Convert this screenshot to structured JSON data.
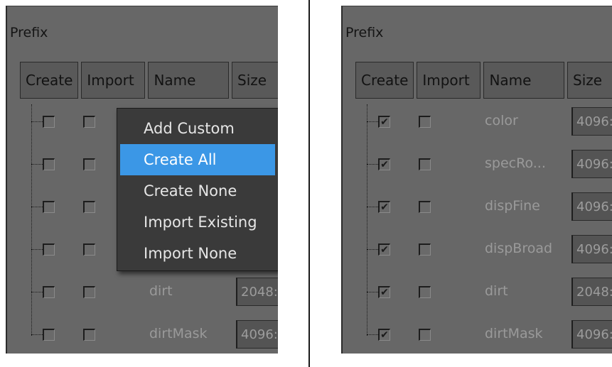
{
  "panels": [
    {
      "prefix_label": "Prefix",
      "columns": [
        "Create",
        "Import",
        "Name",
        "Size"
      ],
      "rows": [
        {
          "create": "",
          "import": "",
          "name": "",
          "size": ""
        },
        {
          "create": "",
          "import": "",
          "name": "",
          "size": ""
        },
        {
          "create": "",
          "import": "",
          "name": "",
          "size": ""
        },
        {
          "create": "",
          "import": "",
          "name": "",
          "size": ""
        },
        {
          "create": "",
          "import": "",
          "name": "dirt",
          "size": "2048:"
        },
        {
          "create": "",
          "import": "",
          "name": "dirtMask",
          "size": "4096:"
        }
      ],
      "context_menu": {
        "items": [
          "Add Custom",
          "Create All",
          "Create None",
          "Import Existing",
          "Import None"
        ],
        "highlighted": "Create All"
      }
    },
    {
      "prefix_label": "Prefix",
      "columns": [
        "Create",
        "Import",
        "Name",
        "Size"
      ],
      "rows": [
        {
          "create": "✔",
          "import": "",
          "name": "color",
          "size": "4096:"
        },
        {
          "create": "✔",
          "import": "",
          "name": "specRo...",
          "size": "4096:"
        },
        {
          "create": "✔",
          "import": "",
          "name": "dispFine",
          "size": "4096:"
        },
        {
          "create": "✔",
          "import": "",
          "name": "dispBroad",
          "size": "4096:"
        },
        {
          "create": "✔",
          "import": "",
          "name": "dirt",
          "size": "2048:"
        },
        {
          "create": "✔",
          "import": "",
          "name": "dirtMask",
          "size": "4096:"
        }
      ]
    }
  ]
}
